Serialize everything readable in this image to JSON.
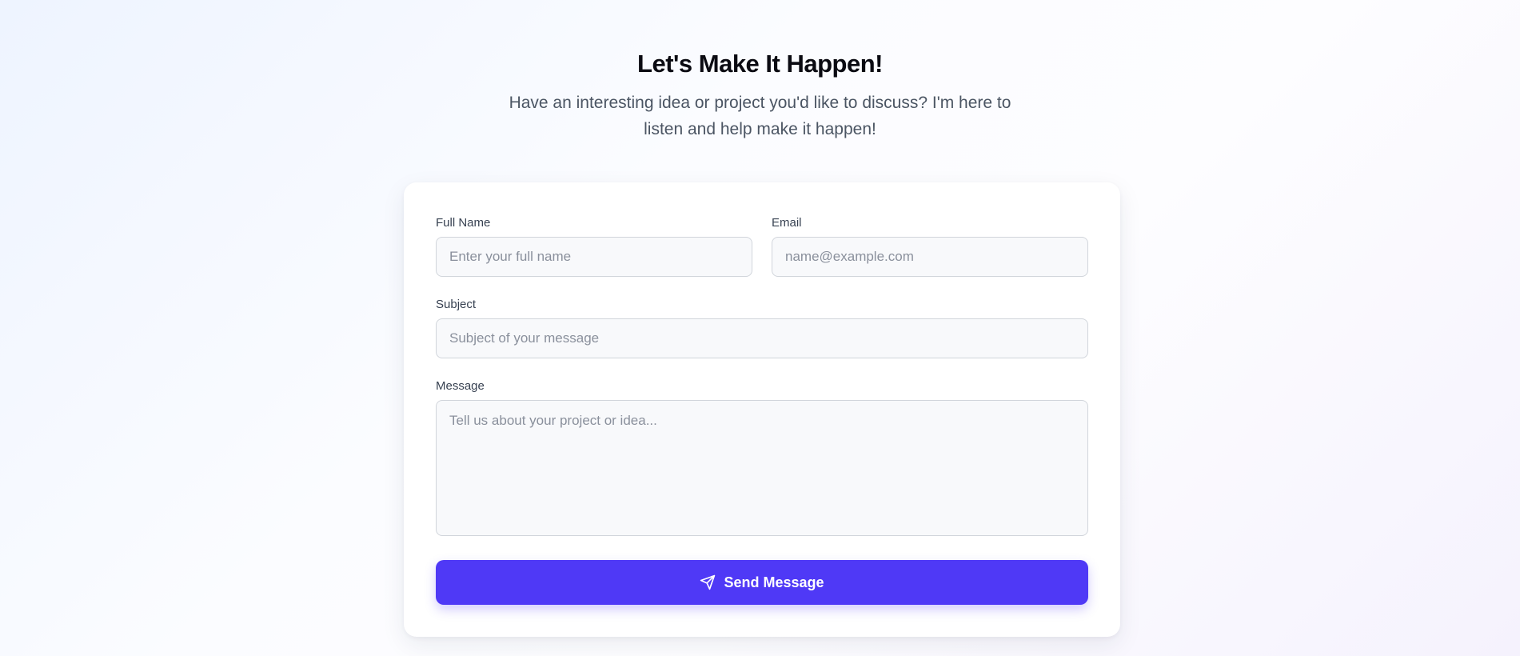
{
  "hero": {
    "title": "Let's Make It Happen!",
    "subtitle": "Have an interesting idea or project you'd like to discuss? I'm here to listen and help make it happen!"
  },
  "form": {
    "full_name": {
      "label": "Full Name",
      "placeholder": "Enter your full name",
      "value": ""
    },
    "email": {
      "label": "Email",
      "placeholder": "name@example.com",
      "value": ""
    },
    "subject": {
      "label": "Subject",
      "placeholder": "Subject of your message",
      "value": ""
    },
    "message": {
      "label": "Message",
      "placeholder": "Tell us about your project or idea...",
      "value": ""
    },
    "submit": {
      "label": "Send Message",
      "icon": "send-icon",
      "color": "#4f39f6"
    }
  }
}
